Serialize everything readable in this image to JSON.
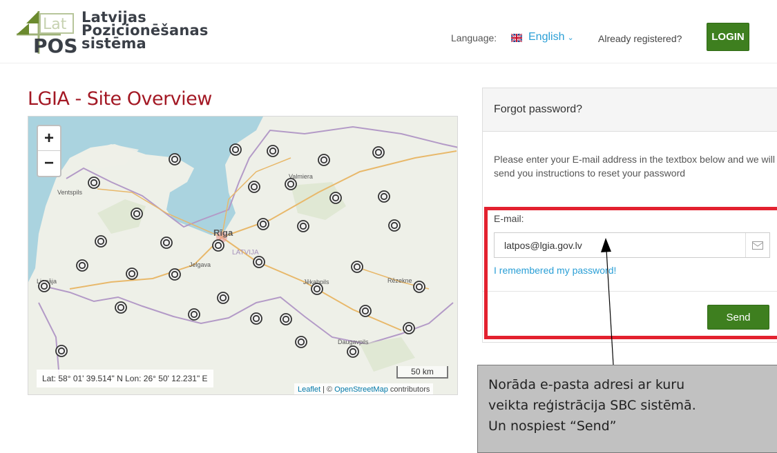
{
  "header": {
    "logo": {
      "lines": [
        "Latvijas",
        "Pozicionēšanas",
        "sistēma"
      ],
      "icon_text": "LatPOS"
    },
    "language_label": "Language:",
    "language_value": "English",
    "already_registered": "Already registered?",
    "login_label": "LOGIN"
  },
  "main": {
    "title": "LGIA - Site Overview",
    "map": {
      "zoom_in": "+",
      "zoom_out": "−",
      "coordinates": "Lat: 58° 01' 39.514\" N Lon: 26° 50' 12.231\" E",
      "scale": "50 km",
      "attribution_leaflet": "Leaflet",
      "attribution_sep": " | © ",
      "attribution_osm": "OpenStreetMap",
      "attribution_tail": " contributors",
      "place_labels": [
        "Ventspils",
        "Rīga",
        "Valmiera",
        "Jelgava",
        "Jēkabpils",
        "Rēzekne",
        "Daugavpils",
        "LATVIJA",
        "Liepāja"
      ]
    }
  },
  "forgot": {
    "title": "Forgot password?",
    "description": "Please enter your E-mail address in the textbox below and we will send you instructions to reset your password",
    "email_label": "E-mail:",
    "email_value": "latpos@lgia.gov.lv",
    "remember_link": "I remembered my password!",
    "send_label": "Send"
  },
  "annotation": {
    "lines": [
      "Norāda e-pasta adresi ar kuru",
      "veikta reģistrācija SBC sistēmā.",
      "Un nospiest “Send”"
    ]
  },
  "colors": {
    "accent_green": "#3e7f1f",
    "title_red": "#a31824",
    "link_blue": "#2a9fd6",
    "highlight_red": "#e3212f"
  }
}
